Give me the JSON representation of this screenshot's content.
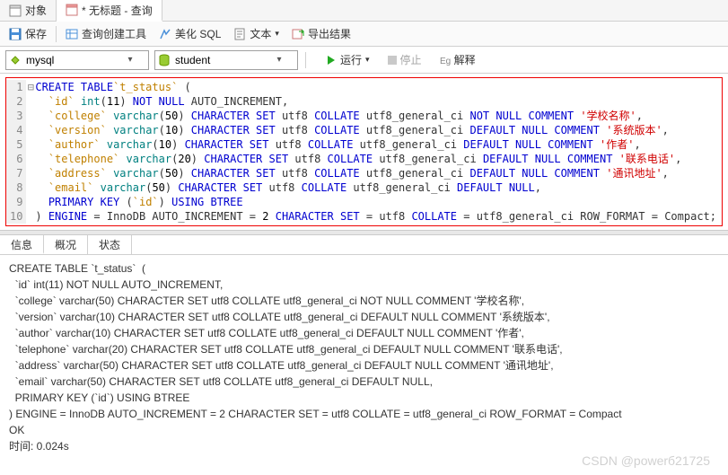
{
  "tabs": {
    "object": "对象",
    "query": "无标题 - 查询",
    "query_prefix": "*"
  },
  "toolbar": {
    "save": "保存",
    "builder": "查询创建工具",
    "beautify": "美化 SQL",
    "text": "文本",
    "text_arrow": "▾",
    "export": "导出结果"
  },
  "selectors": {
    "db": "mysql",
    "schema": "student",
    "run": "运行",
    "run_arrow": "▾",
    "stop": "停止",
    "explain": "解释"
  },
  "code_lines": [
    {
      "n": 1,
      "fold": "⊟",
      "seg": [
        [
          "kw",
          "CREATE TABLE"
        ],
        [
          "",
          ""
        ],
        [
          "id",
          "`t_status`"
        ],
        [
          "",
          " ("
        ]
      ]
    },
    {
      "n": 2,
      "seg": [
        [
          "",
          "  "
        ],
        [
          "id",
          "`id`"
        ],
        [
          "",
          " "
        ],
        [
          "ty",
          "int"
        ],
        [
          "",
          "("
        ],
        [
          "num",
          "11"
        ],
        [
          "",
          ") "
        ],
        [
          "kw",
          "NOT NULL"
        ],
        [
          "",
          " AUTO_INCREMENT,"
        ]
      ]
    },
    {
      "n": 3,
      "seg": [
        [
          "",
          "  "
        ],
        [
          "id",
          "`college`"
        ],
        [
          "",
          " "
        ],
        [
          "ty",
          "varchar"
        ],
        [
          "",
          "("
        ],
        [
          "num",
          "50"
        ],
        [
          "",
          ") "
        ],
        [
          "kw",
          "CHARACTER SET"
        ],
        [
          "",
          " utf8 "
        ],
        [
          "kw",
          "COLLATE"
        ],
        [
          "",
          " utf8_general_ci "
        ],
        [
          "kw",
          "NOT NULL COMMENT"
        ],
        [
          "",
          " "
        ],
        [
          "str",
          "'学校名称'"
        ],
        [
          "",
          ","
        ]
      ]
    },
    {
      "n": 4,
      "seg": [
        [
          "",
          "  "
        ],
        [
          "id",
          "`version`"
        ],
        [
          "",
          " "
        ],
        [
          "ty",
          "varchar"
        ],
        [
          "",
          "("
        ],
        [
          "num",
          "10"
        ],
        [
          "",
          ") "
        ],
        [
          "kw",
          "CHARACTER SET"
        ],
        [
          "",
          " utf8 "
        ],
        [
          "kw",
          "COLLATE"
        ],
        [
          "",
          " utf8_general_ci "
        ],
        [
          "kw",
          "DEFAULT NULL COMMENT"
        ],
        [
          "",
          " "
        ],
        [
          "str",
          "'系统版本'"
        ],
        [
          "",
          ","
        ]
      ]
    },
    {
      "n": 5,
      "seg": [
        [
          "",
          "  "
        ],
        [
          "id",
          "`author`"
        ],
        [
          "",
          " "
        ],
        [
          "ty",
          "varchar"
        ],
        [
          "",
          "("
        ],
        [
          "num",
          "10"
        ],
        [
          "",
          ") "
        ],
        [
          "kw",
          "CHARACTER SET"
        ],
        [
          "",
          " utf8 "
        ],
        [
          "kw",
          "COLLATE"
        ],
        [
          "",
          " utf8_general_ci "
        ],
        [
          "kw",
          "DEFAULT NULL COMMENT"
        ],
        [
          "",
          " "
        ],
        [
          "str",
          "'作者'"
        ],
        [
          "",
          ","
        ]
      ]
    },
    {
      "n": 6,
      "seg": [
        [
          "",
          "  "
        ],
        [
          "id",
          "`telephone`"
        ],
        [
          "",
          " "
        ],
        [
          "ty",
          "varchar"
        ],
        [
          "",
          "("
        ],
        [
          "num",
          "20"
        ],
        [
          "",
          ") "
        ],
        [
          "kw",
          "CHARACTER SET"
        ],
        [
          "",
          " utf8 "
        ],
        [
          "kw",
          "COLLATE"
        ],
        [
          "",
          " utf8_general_ci "
        ],
        [
          "kw",
          "DEFAULT NULL COMMENT"
        ],
        [
          "",
          " "
        ],
        [
          "str",
          "'联系电话'"
        ],
        [
          "",
          ","
        ]
      ]
    },
    {
      "n": 7,
      "seg": [
        [
          "",
          "  "
        ],
        [
          "id",
          "`address`"
        ],
        [
          "",
          " "
        ],
        [
          "ty",
          "varchar"
        ],
        [
          "",
          "("
        ],
        [
          "num",
          "50"
        ],
        [
          "",
          ") "
        ],
        [
          "kw",
          "CHARACTER SET"
        ],
        [
          "",
          " utf8 "
        ],
        [
          "kw",
          "COLLATE"
        ],
        [
          "",
          " utf8_general_ci "
        ],
        [
          "kw",
          "DEFAULT NULL COMMENT"
        ],
        [
          "",
          " "
        ],
        [
          "str",
          "'通讯地址'"
        ],
        [
          "",
          ","
        ]
      ]
    },
    {
      "n": 8,
      "seg": [
        [
          "",
          "  "
        ],
        [
          "id",
          "`email`"
        ],
        [
          "",
          " "
        ],
        [
          "ty",
          "varchar"
        ],
        [
          "",
          "("
        ],
        [
          "num",
          "50"
        ],
        [
          "",
          ") "
        ],
        [
          "kw",
          "CHARACTER SET"
        ],
        [
          "",
          " utf8 "
        ],
        [
          "kw",
          "COLLATE"
        ],
        [
          "",
          " utf8_general_ci "
        ],
        [
          "kw",
          "DEFAULT NULL"
        ],
        [
          "",
          ","
        ]
      ]
    },
    {
      "n": 9,
      "seg": [
        [
          "",
          "  "
        ],
        [
          "kw",
          "PRIMARY KEY"
        ],
        [
          "",
          " ("
        ],
        [
          "id",
          "`id`"
        ],
        [
          "",
          ") "
        ],
        [
          "kw",
          "USING BTREE"
        ]
      ]
    },
    {
      "n": 10,
      "fold": "",
      "seg": [
        [
          "",
          ") "
        ],
        [
          "kw",
          "ENGINE"
        ],
        [
          "",
          " = InnoDB AUTO_INCREMENT = "
        ],
        [
          "num",
          "2"
        ],
        [
          "",
          " "
        ],
        [
          "kw",
          "CHARACTER SET"
        ],
        [
          "",
          " = utf8 "
        ],
        [
          "kw",
          "COLLATE"
        ],
        [
          "",
          " = utf8_general_ci ROW_FORMAT = Compact;"
        ]
      ]
    }
  ],
  "result_tabs": {
    "info": "信息",
    "profile": "概况",
    "status": "状态"
  },
  "result_text": "CREATE TABLE `t_status`  (\n  `id` int(11) NOT NULL AUTO_INCREMENT,\n  `college` varchar(50) CHARACTER SET utf8 COLLATE utf8_general_ci NOT NULL COMMENT '学校名称',\n  `version` varchar(10) CHARACTER SET utf8 COLLATE utf8_general_ci DEFAULT NULL COMMENT '系统版本',\n  `author` varchar(10) CHARACTER SET utf8 COLLATE utf8_general_ci DEFAULT NULL COMMENT '作者',\n  `telephone` varchar(20) CHARACTER SET utf8 COLLATE utf8_general_ci DEFAULT NULL COMMENT '联系电话',\n  `address` varchar(50) CHARACTER SET utf8 COLLATE utf8_general_ci DEFAULT NULL COMMENT '通讯地址',\n  `email` varchar(50) CHARACTER SET utf8 COLLATE utf8_general_ci DEFAULT NULL,\n  PRIMARY KEY (`id`) USING BTREE\n) ENGINE = InnoDB AUTO_INCREMENT = 2 CHARACTER SET = utf8 COLLATE = utf8_general_ci ROW_FORMAT = Compact\nOK\n时间: 0.024s",
  "watermark": "CSDN @powerб21725"
}
